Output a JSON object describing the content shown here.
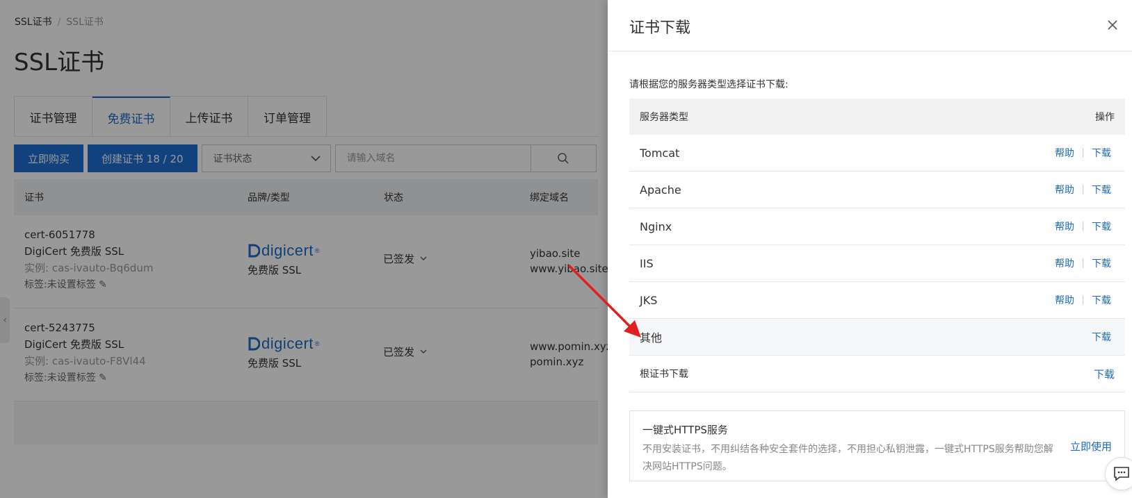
{
  "breadcrumb": {
    "root": "SSL证书",
    "current": "SSL证书"
  },
  "page_title": "SSL证书",
  "tabs": [
    {
      "label": "证书管理"
    },
    {
      "label": "免费证书"
    },
    {
      "label": "上传证书"
    },
    {
      "label": "订单管理"
    }
  ],
  "toolbar": {
    "buy_label": "立即购买",
    "create_label": "创建证书 18 / 20",
    "status_select": "证书状态",
    "search_placeholder": "请输入域名"
  },
  "table": {
    "headers": {
      "cert": "证书",
      "brand": "品牌/类型",
      "status": "状态",
      "domain": "绑定域名"
    },
    "rows": [
      {
        "cert_id": "cert-6051778",
        "cert_name": "DigiCert 免费版 SSL",
        "instance": "实例: cas-ivauto-Bq6dum",
        "tag": "标签:未设置标签",
        "brand_logo": "digicert",
        "brand_type": "免费版 SSL",
        "status": "已签发",
        "domain1": "yibao.site",
        "domain2": "www.yibao.site"
      },
      {
        "cert_id": "cert-5243775",
        "cert_name": "DigiCert 免费版 SSL",
        "instance": "实例: cas-ivauto-F8Vl44",
        "tag": "标签:未设置标签",
        "brand_logo": "digicert",
        "brand_type": "免费版 SSL",
        "status": "已签发",
        "domain1": "www.pomin.xyz",
        "domain2": "pomin.xyz"
      }
    ]
  },
  "drawer": {
    "title": "证书下载",
    "subtitle": "请根据您的服务器类型选择证书下载:",
    "table_headers": {
      "server_type": "服务器类型",
      "action": "操作"
    },
    "help_label": "帮助",
    "download_label": "下载",
    "servers": [
      {
        "name": "Tomcat"
      },
      {
        "name": "Apache"
      },
      {
        "name": "Nginx"
      },
      {
        "name": "IIS"
      },
      {
        "name": "JKS"
      }
    ],
    "other": {
      "name": "其他"
    },
    "root_cert": {
      "name": "根证书下载"
    },
    "https_service": {
      "title": "一键式HTTPS服务",
      "desc": "不用安装证书，不用纠结各种安全套件的选择，不用担心私钥泄露，一键式HTTPS服务帮助您解决网站HTTPS问题。",
      "use_label": "立即使用"
    }
  },
  "colors": {
    "accent": "#1c6bc3",
    "primary_button": "#1f6fd0",
    "annotation_arrow": "#e02020"
  }
}
